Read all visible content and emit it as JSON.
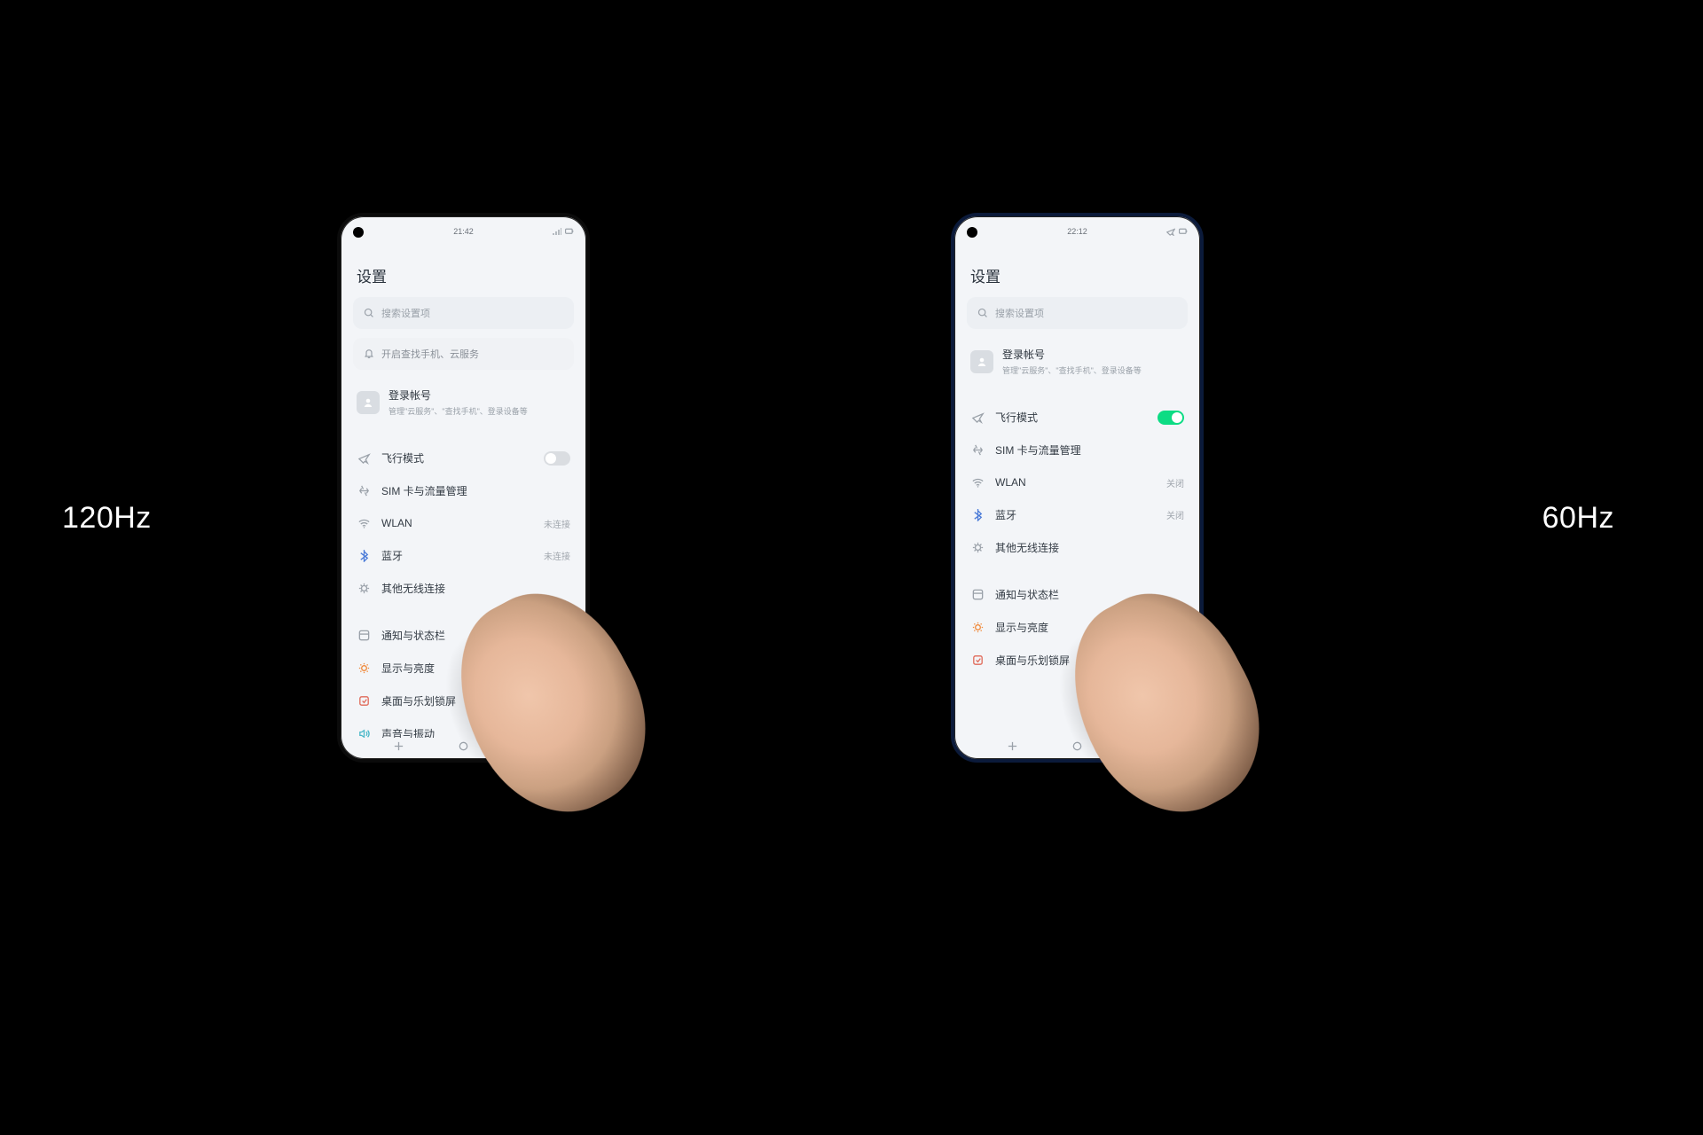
{
  "labels": {
    "left": "120Hz",
    "right": "60Hz"
  },
  "phones": {
    "left": {
      "time": "21:42",
      "title": "设置",
      "search_placeholder": "搜索设置项",
      "cloud_hint": "开启查找手机、云服务",
      "account_title": "登录帐号",
      "account_sub": "管理\"云服务\"、\"查找手机\"、登录设备等",
      "rows": {
        "airplane": "飞行模式",
        "sim": "SIM 卡与流量管理",
        "wlan": "WLAN",
        "wlan_value": "未连接",
        "bt": "蓝牙",
        "bt_value": "未连接",
        "other": "其他无线连接",
        "notif": "通知与状态栏",
        "display": "显示与亮度",
        "home": "桌面与乐划锁屏",
        "sound": "声音与振动"
      },
      "airplane_on": false
    },
    "right": {
      "time": "22:12",
      "title": "设置",
      "search_placeholder": "搜索设置项",
      "account_title": "登录帐号",
      "account_sub": "管理\"云服务\"、\"查找手机\"、登录设备等",
      "rows": {
        "airplane": "飞行模式",
        "sim": "SIM 卡与流量管理",
        "wlan": "WLAN",
        "wlan_value": "关闭",
        "bt": "蓝牙",
        "bt_value": "关闭",
        "other": "其他无线连接",
        "notif": "通知与状态栏",
        "display": "显示与亮度",
        "home": "桌面与乐划锁屏"
      },
      "airplane_on": true
    }
  }
}
